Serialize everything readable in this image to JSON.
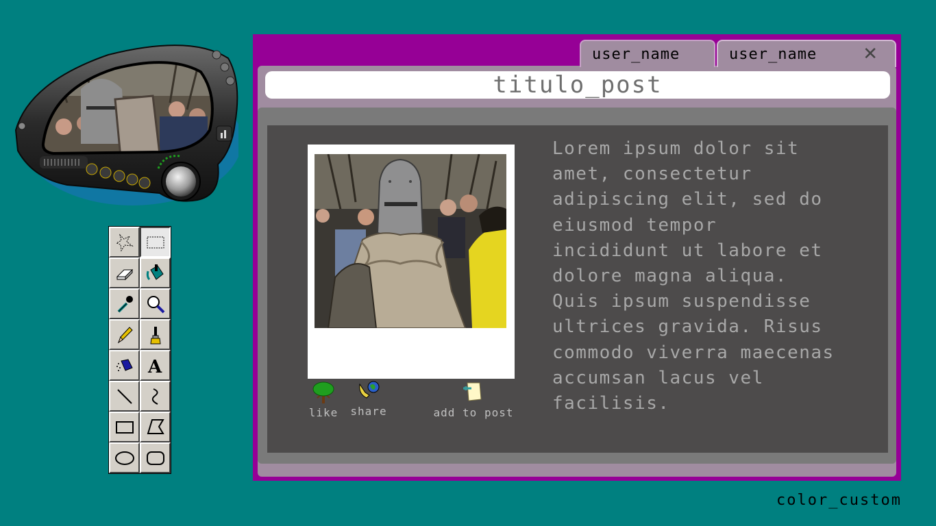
{
  "window": {
    "tabs": [
      {
        "label": "user_name"
      },
      {
        "label": "user_name"
      }
    ],
    "close_label": "✕",
    "post_title": "titulo_post",
    "body_text": "Lorem ipsum dolor sit\namet, consectetur\nadipiscing elit, sed do\neiusmod tempor\nincididunt ut labore et\ndolore magna aliqua.\nQuis ipsum suspendisse\nultrices gravida. Risus\ncommodo viverra maecenas\naccumsan lacus vel\nfacilisis.",
    "actions": {
      "like": "like",
      "share": "share",
      "add": "add to post"
    }
  },
  "footer": {
    "color_label": "color_custom"
  },
  "colors": {
    "background": "#008080",
    "window_frame": "#960096",
    "window_body": "#a08ca0",
    "content_panel": "#4d4b4b",
    "body_text": "#a8a8a8"
  },
  "toolbox": {
    "tools": [
      {
        "icon": "free-select-icon"
      },
      {
        "icon": "rect-select-icon"
      },
      {
        "icon": "eraser-icon"
      },
      {
        "icon": "fill-bucket-icon"
      },
      {
        "icon": "color-picker-icon"
      },
      {
        "icon": "magnifier-icon"
      },
      {
        "icon": "pencil-icon"
      },
      {
        "icon": "brush-icon"
      },
      {
        "icon": "airbrush-icon"
      },
      {
        "icon": "text-icon"
      },
      {
        "icon": "line-icon"
      },
      {
        "icon": "curve-icon"
      },
      {
        "icon": "rectangle-icon"
      },
      {
        "icon": "polygon-icon"
      },
      {
        "icon": "ellipse-icon"
      },
      {
        "icon": "rounded-rect-icon"
      }
    ]
  }
}
